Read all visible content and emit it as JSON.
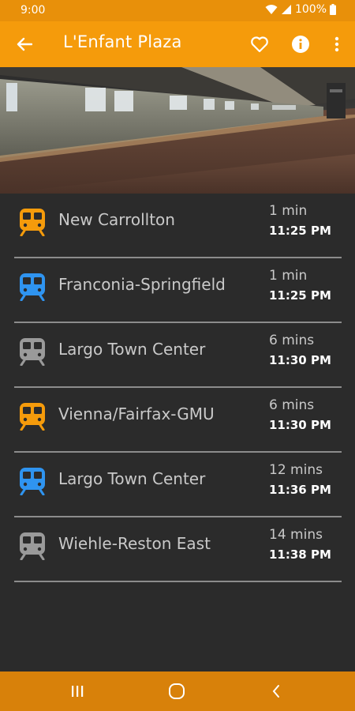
{
  "status_bar": {
    "time": "9:00",
    "battery": "100%"
  },
  "app_bar": {
    "title": "L'Enfant Plaza",
    "back_icon": "arrow-left-icon",
    "favorite_icon": "heart-outline-icon",
    "info_icon": "info-circle-icon",
    "more_icon": "more-vertical-icon"
  },
  "hero_image": "metro-station-platform",
  "colors": {
    "app_bar": "#f59b0b",
    "status_bar": "#e8900a",
    "background": "#2b2b2b",
    "divider": "#8c8c8c",
    "orange_line": "#f59b0b",
    "blue_line": "#2f94f0",
    "silver_line": "#9a9a9a"
  },
  "arrivals": [
    {
      "line": "orange",
      "color": "#f59b0b",
      "destination": "New Carrollton",
      "eta": "1 min",
      "time": "11:25 PM"
    },
    {
      "line": "blue",
      "color": "#2f94f0",
      "destination": "Franconia-Springfield",
      "eta": "1 min",
      "time": "11:25 PM"
    },
    {
      "line": "silver",
      "color": "#9a9a9a",
      "destination": "Largo Town Center",
      "eta": "6 mins",
      "time": "11:30 PM"
    },
    {
      "line": "orange",
      "color": "#f59b0b",
      "destination": "Vienna/Fairfax-GMU",
      "eta": "6 mins",
      "time": "11:30 PM"
    },
    {
      "line": "blue",
      "color": "#2f94f0",
      "destination": "Largo Town Center",
      "eta": "12 mins",
      "time": "11:36 PM"
    },
    {
      "line": "silver",
      "color": "#9a9a9a",
      "destination": "Wiehle-Reston East",
      "eta": "14 mins",
      "time": "11:38 PM"
    }
  ],
  "nav_bar": {
    "recents_icon": "recent-apps-icon",
    "home_icon": "home-circle-icon",
    "back_icon": "nav-back-chevron-icon"
  }
}
